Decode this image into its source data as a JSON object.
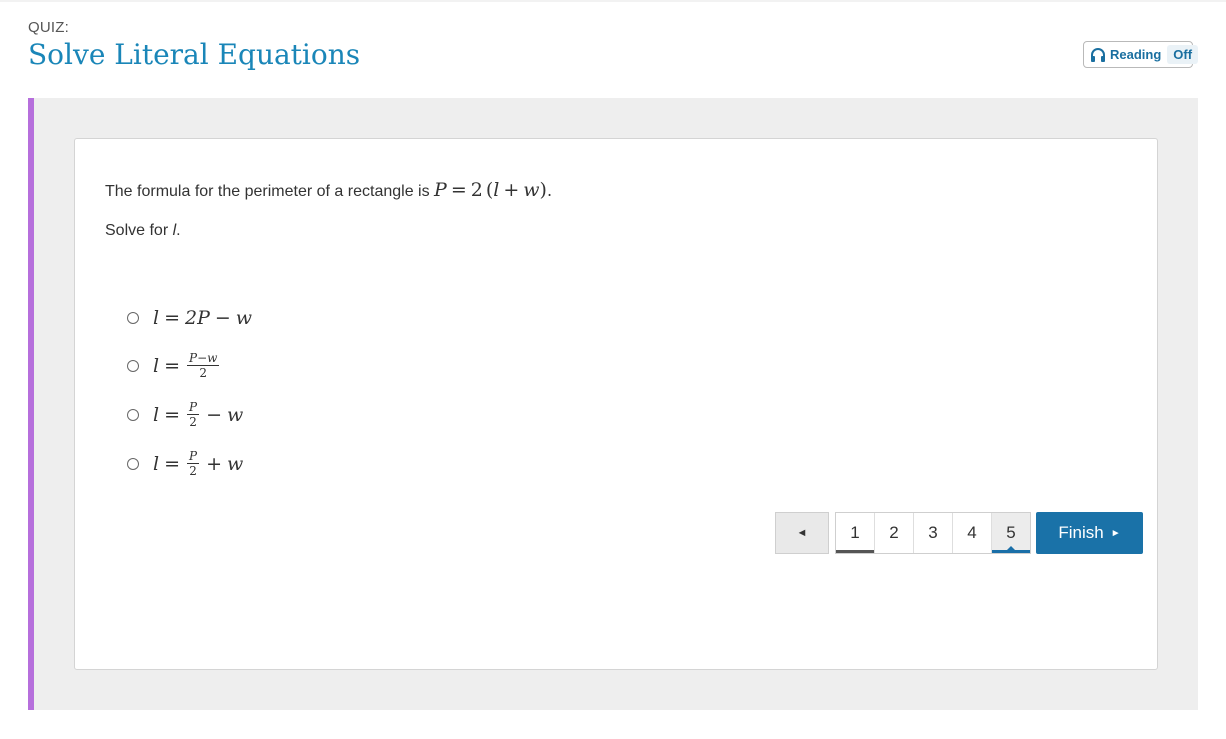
{
  "header": {
    "quiz_label": "QUIZ:",
    "title": "Solve Literal Equations",
    "reading_label": "Reading",
    "reading_state": "Off"
  },
  "question": {
    "text": "The formula for the perimeter of a rectangle is",
    "formula": {
      "lhs": "P",
      "eq": "=",
      "coef": "2",
      "lparen": "(",
      "a": "l",
      "plus": "+",
      "b": "w",
      "rparen": ")",
      "end": "."
    },
    "instruction_prefix": "Solve for",
    "instruction_var": "l",
    "instruction_suffix": "."
  },
  "choices": [
    {
      "var": "l",
      "eq": "=",
      "part1": "2P",
      "op": "−",
      "part2": "w"
    },
    {
      "var": "l",
      "eq": "=",
      "num": "P−w",
      "den": "2"
    },
    {
      "var": "l",
      "eq": "=",
      "num": "P",
      "den": "2",
      "op": "−",
      "tail": "w"
    },
    {
      "var": "l",
      "eq": "=",
      "num": "P",
      "den": "2",
      "op": "+",
      "tail": "w"
    }
  ],
  "pagination": {
    "prev_symbol": "◄",
    "pages": [
      "1",
      "2",
      "3",
      "4",
      "5"
    ],
    "current_page": "5",
    "finish_label": "Finish",
    "finish_symbol": "►"
  },
  "colors": {
    "title": "#1a86b8",
    "accent_bar": "#b66fdc",
    "finish_button": "#1a72a8",
    "panel_bg": "#eeeeee"
  }
}
